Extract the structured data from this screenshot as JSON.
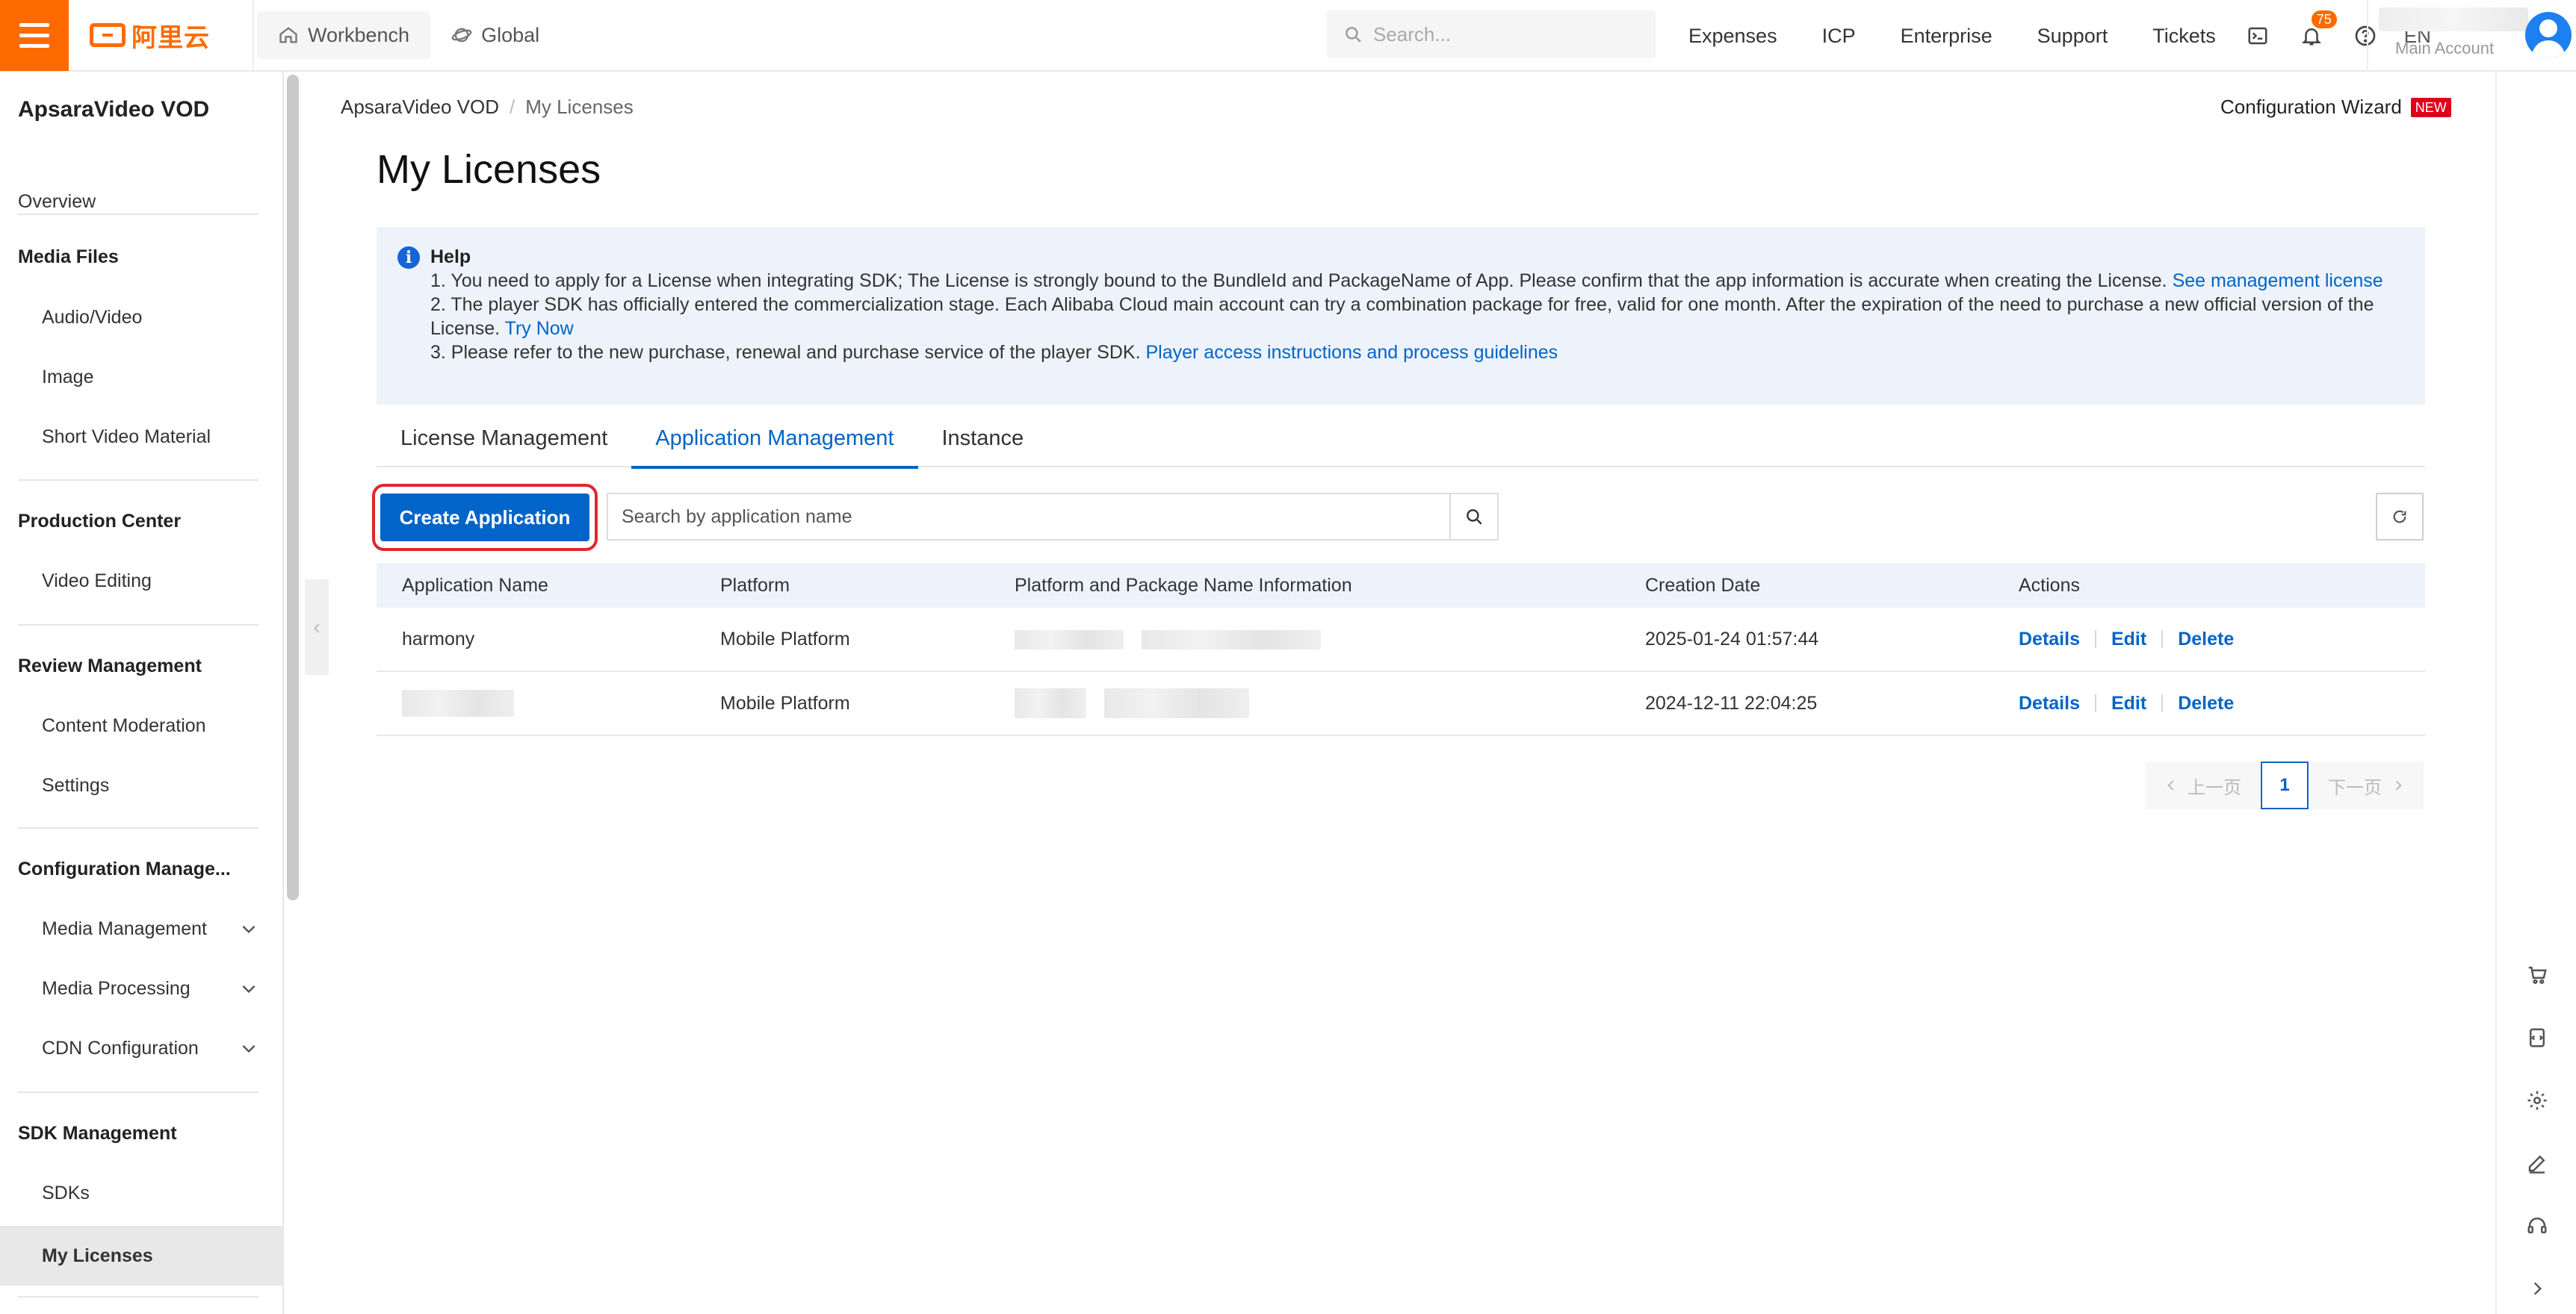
{
  "topbar": {
    "logo_text": "阿里云",
    "workbench": "Workbench",
    "global": "Global",
    "search_placeholder": "Search...",
    "links": [
      "Expenses",
      "ICP",
      "Enterprise",
      "Support",
      "Tickets"
    ],
    "notification_count": "75",
    "language": "EN",
    "account_label": "Main Account",
    "accent_color": "#ff6a00"
  },
  "sidebar": {
    "title": "ApsaraVideo VOD",
    "overview": "Overview",
    "sections": [
      {
        "title": "Media Files",
        "items": [
          "Audio/Video",
          "Image",
          "Short Video Material"
        ]
      },
      {
        "title": "Production Center",
        "items": [
          "Video Editing"
        ]
      },
      {
        "title": "Review Management",
        "items": [
          "Content Moderation",
          "Settings"
        ]
      },
      {
        "title": "Configuration Manage...",
        "items": [
          "Media Management",
          "Media Processing",
          "CDN Configuration"
        ]
      },
      {
        "title": "SDK Management",
        "items": [
          "SDKs",
          "My Licenses"
        ]
      }
    ],
    "active_item": "My Licenses"
  },
  "breadcrumb": {
    "root": "ApsaraVideo VOD",
    "separator": "/",
    "current": "My Licenses"
  },
  "wizard": {
    "label": "Configuration Wizard",
    "badge": "NEW"
  },
  "page_title": "My Licenses",
  "help": {
    "title": "Help",
    "line1": "1. You need to apply for a License when integrating SDK; The License is strongly bound to the BundleId and PackageName of App. Please confirm that the app information is accurate when creating the License. ",
    "line1_link": "See management license",
    "line2": "2. The player SDK has officially entered the commercialization stage. Each Alibaba Cloud main account can try a combination package for free, valid for one month. After the expiration of the need to purchase a new official version of the License. ",
    "line2_link": "Try Now",
    "line3": "3. Please refer to the new purchase, renewal and purchase service of the player SDK. ",
    "line3_link": "Player access instructions and process guidelines"
  },
  "tabs": [
    "License Management",
    "Application Management",
    "Instance"
  ],
  "active_tab": "Application Management",
  "toolbar": {
    "create_label": "Create Application",
    "search_placeholder": "Search by application name"
  },
  "table": {
    "headers": [
      "Application Name",
      "Platform",
      "Platform and Package Name Information",
      "Creation Date",
      "Actions"
    ],
    "rows": [
      {
        "name": "harmony",
        "platform": "Mobile Platform",
        "date": "2025-01-24 01:57:44"
      },
      {
        "name": "",
        "platform": "Mobile Platform",
        "date": "2024-12-11 22:04:25"
      }
    ],
    "actions": [
      "Details",
      "Edit",
      "Delete"
    ]
  },
  "pager": {
    "prev": "上一页",
    "page": "1",
    "next": "下一页"
  }
}
